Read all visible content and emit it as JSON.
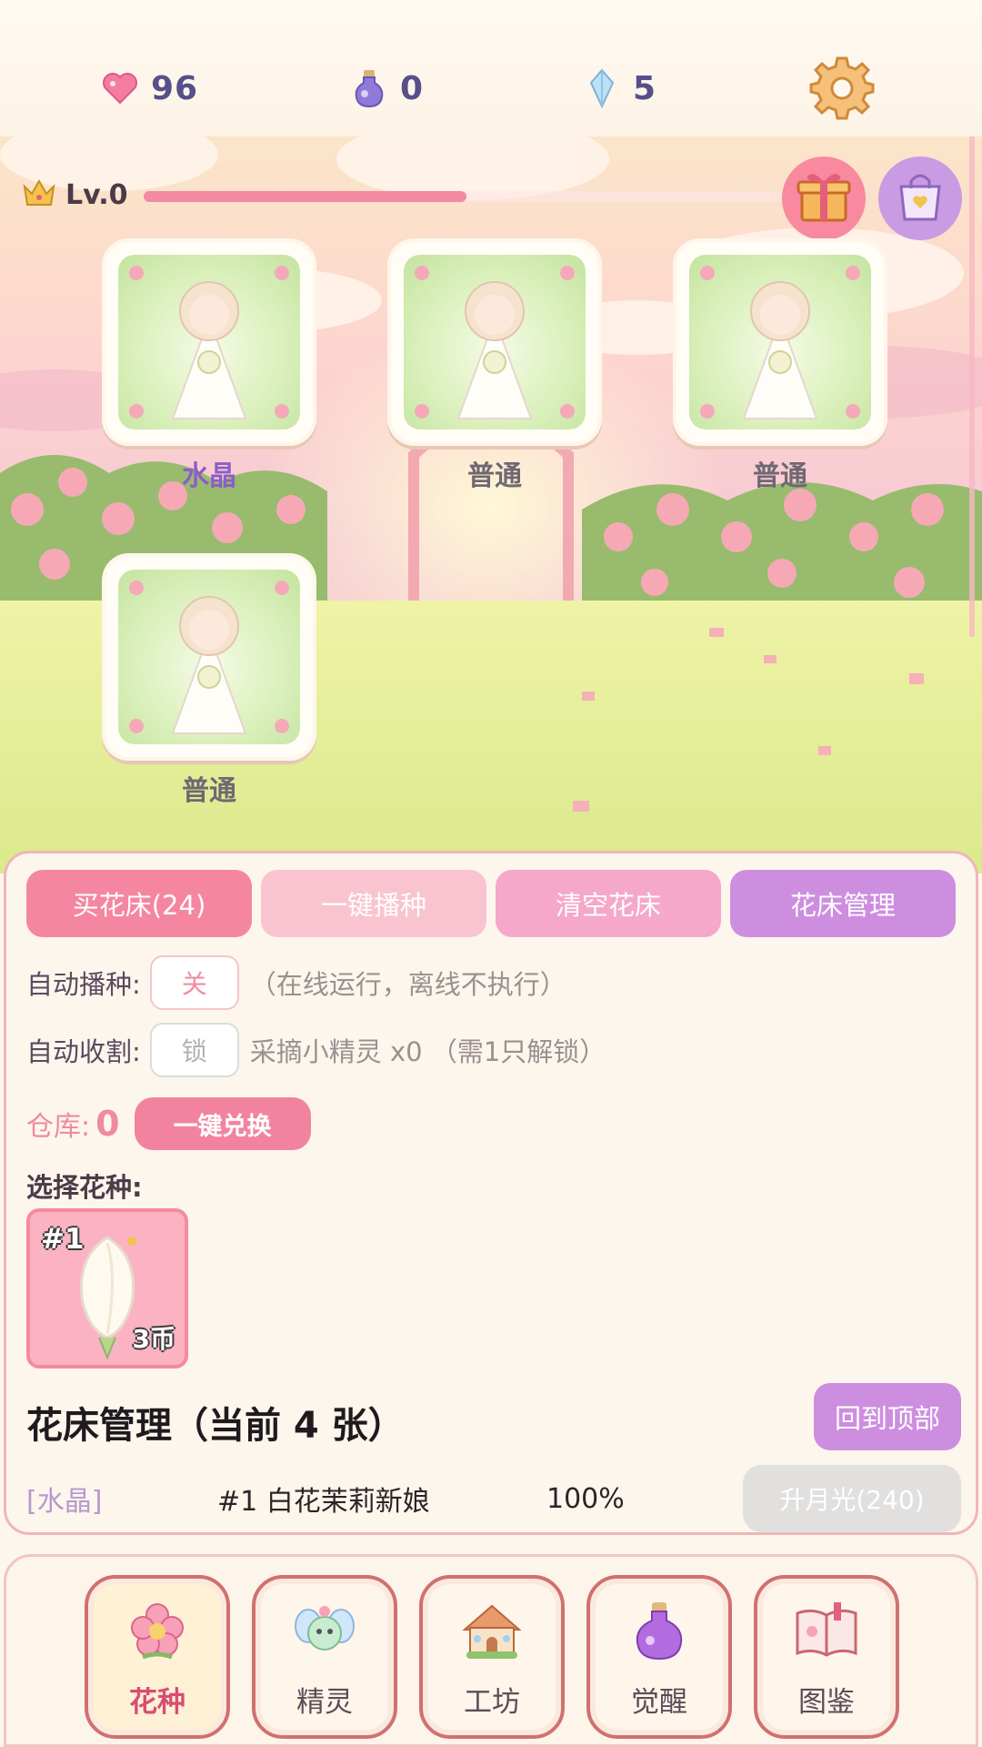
{
  "resources": {
    "hearts": "96",
    "potions": "0",
    "crystals": "5"
  },
  "level": {
    "label": "Lv.0",
    "progress": 0.5
  },
  "beds": [
    {
      "grade": "水晶"
    },
    {
      "grade": "普通"
    },
    {
      "grade": "普通"
    },
    {
      "grade": "普通"
    }
  ],
  "tabs": [
    "买花床(24)",
    "一键播种",
    "清空花床",
    "花床管理"
  ],
  "auto_sow": {
    "label": "自动播种:",
    "toggle": "关",
    "note": "（在线运行，离线不执行）"
  },
  "auto_harvest": {
    "label": "自动收割:",
    "toggle": "锁",
    "note": "采摘小精灵 x0 （需1只解锁）"
  },
  "warehouse": {
    "label": "仓库:",
    "count": "0",
    "exchange": "一键兑换"
  },
  "seed_section": {
    "title": "选择花种:",
    "seeds": [
      {
        "num": "#1",
        "price": "3币"
      }
    ]
  },
  "bed_management": {
    "title": "花床管理（当前 4 张）",
    "back_to_top": "回到顶部",
    "rows": [
      {
        "type": "[水晶]",
        "name": "#1 白花茉莉新娘",
        "percent": "100%",
        "upgrade": "升月光(240)"
      }
    ]
  },
  "nav": [
    "花种",
    "精灵",
    "工坊",
    "觉醒",
    "图鉴"
  ],
  "colors": {
    "accent_pink": "#f586a1",
    "accent_purple": "#cd8ee0",
    "crystal_text": "#8b5fc7",
    "panel_border": "#f0b6b8"
  }
}
